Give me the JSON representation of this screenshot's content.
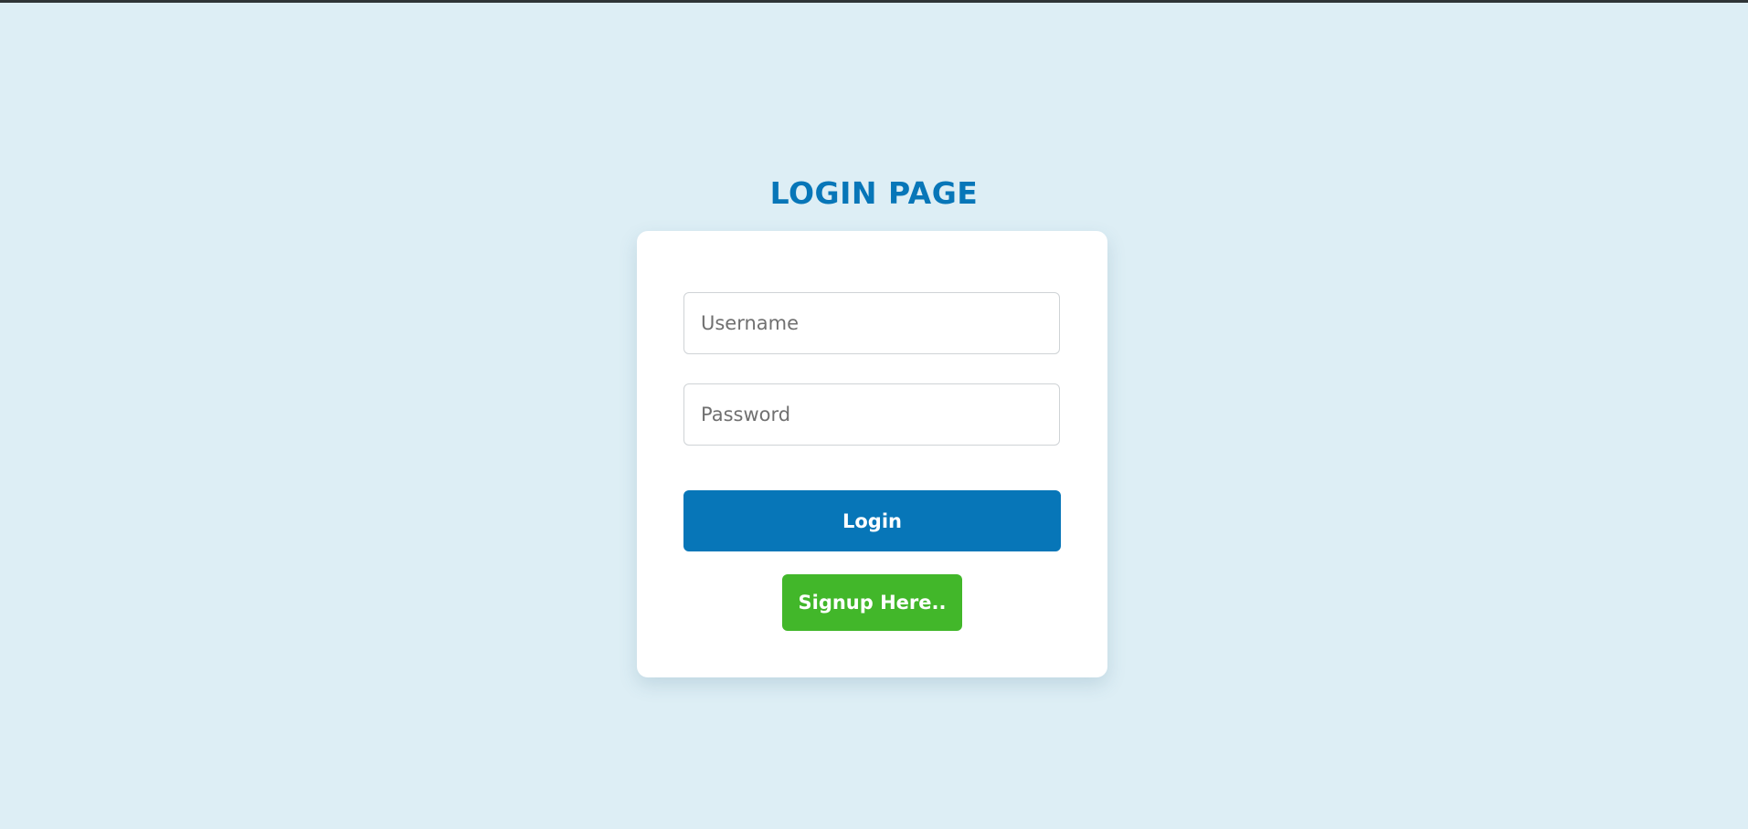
{
  "page": {
    "title": "LOGIN PAGE"
  },
  "form": {
    "username_placeholder": "Username",
    "username_value": "",
    "password_placeholder": "Password",
    "password_value": "",
    "login_label": "Login",
    "signup_label": "Signup Here.."
  },
  "colors": {
    "background": "#ddeef5",
    "accent": "#0776b8",
    "signup": "#42b72a",
    "card": "#ffffff"
  }
}
